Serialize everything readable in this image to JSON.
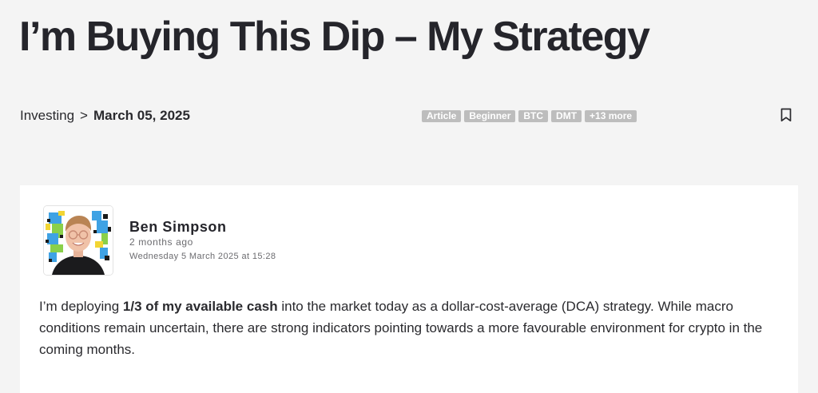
{
  "article": {
    "title": "I’m Buying This Dip – My Strategy"
  },
  "breadcrumb": {
    "category": "Investing",
    "separator": ">",
    "date": "March 05, 2025"
  },
  "tags": [
    "Article",
    "Beginner",
    "BTC",
    "DMT",
    "+13 more"
  ],
  "bookmark": {
    "icon": "bookmark-icon"
  },
  "author": {
    "name": "Ben Simpson",
    "relative_time": "2 months ago",
    "timestamp": "Wednesday 5 March 2025 at 15:28"
  },
  "body": {
    "intro_before": "I’m deploying ",
    "intro_bold": "1/3 of my available cash",
    "intro_after": " into the market today as a dollar-cost-average (DCA) strategy. While macro conditions remain uncertain, there are strong indicators pointing towards a more favourable environment for crypto in the coming months."
  },
  "colors": {
    "background": "#f4f4f4",
    "card": "#ffffff",
    "tag_background": "#bdbdbd",
    "text": "#25252b"
  }
}
